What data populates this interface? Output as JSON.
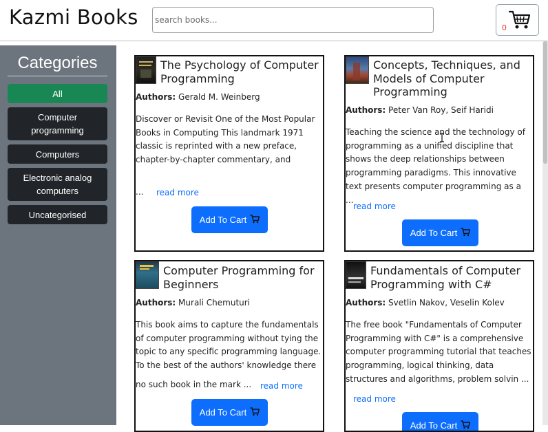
{
  "header": {
    "brand": "Kazmi Books",
    "search_placeholder": "search books...",
    "cart_count": "0",
    "cart_icon": "cart-icon"
  },
  "sidebar": {
    "title": "Categories",
    "items": [
      {
        "label": "All",
        "active": true
      },
      {
        "label": "Computer programming",
        "active": false
      },
      {
        "label": "Computers",
        "active": false
      },
      {
        "label": "Electronic analog computers",
        "active": false
      },
      {
        "label": "Uncategorised",
        "active": false
      }
    ]
  },
  "books": [
    {
      "title": "The Psychology of Computer Programming",
      "authors_label": "Authors:",
      "authors": "Gerald M. Weinberg",
      "description": "Discover or Revisit One of the Most Popular Books in Computing This landmark 1971 classic is reprinted with a new preface, chapter-by-chapter commentary, and straight-from-the-heart observations on to ...",
      "read_more": "read more",
      "add_to_cart": "Add To Cart"
    },
    {
      "title": "Concepts, Techniques, and Models of Computer Programming",
      "authors_label": "Authors:",
      "authors": "Peter Van Roy, Seif Haridi",
      "description": "Teaching the science and the technology of programming as a unified discipline that shows the deep relationships between programming paradigms. This innovative text presents computer programming as a ...",
      "read_more": "read more",
      "add_to_cart": "Add To Cart"
    },
    {
      "title": "Computer Programming for Beginners",
      "authors_label": "Authors:",
      "authors": "Murali Chemuturi",
      "description": "This book aims to capture the fundamentals of computer programming without tying the topic to any specific programming language. To the best of the authors' knowledge there is no such book in the mark ...",
      "read_more": "read more",
      "add_to_cart": "Add To Cart"
    },
    {
      "title": "Fundamentals of Computer Programming with C#",
      "authors_label": "Authors:",
      "authors": "Svetlin Nakov, Veselin Kolev",
      "description": "The free book \"Fundamentals of Computer Programming with C#\" is a comprehensive computer programming tutorial that teaches programming, logical thinking, data structures and algorithms, problem solvin ...",
      "read_more": "read more",
      "add_to_cart": "Add To Cart"
    }
  ],
  "colors": {
    "primary": "#0d6efd",
    "success": "#198754",
    "sidebar_bg": "#6c757d",
    "dark": "#212529",
    "cart_count": "#e03b2e"
  }
}
